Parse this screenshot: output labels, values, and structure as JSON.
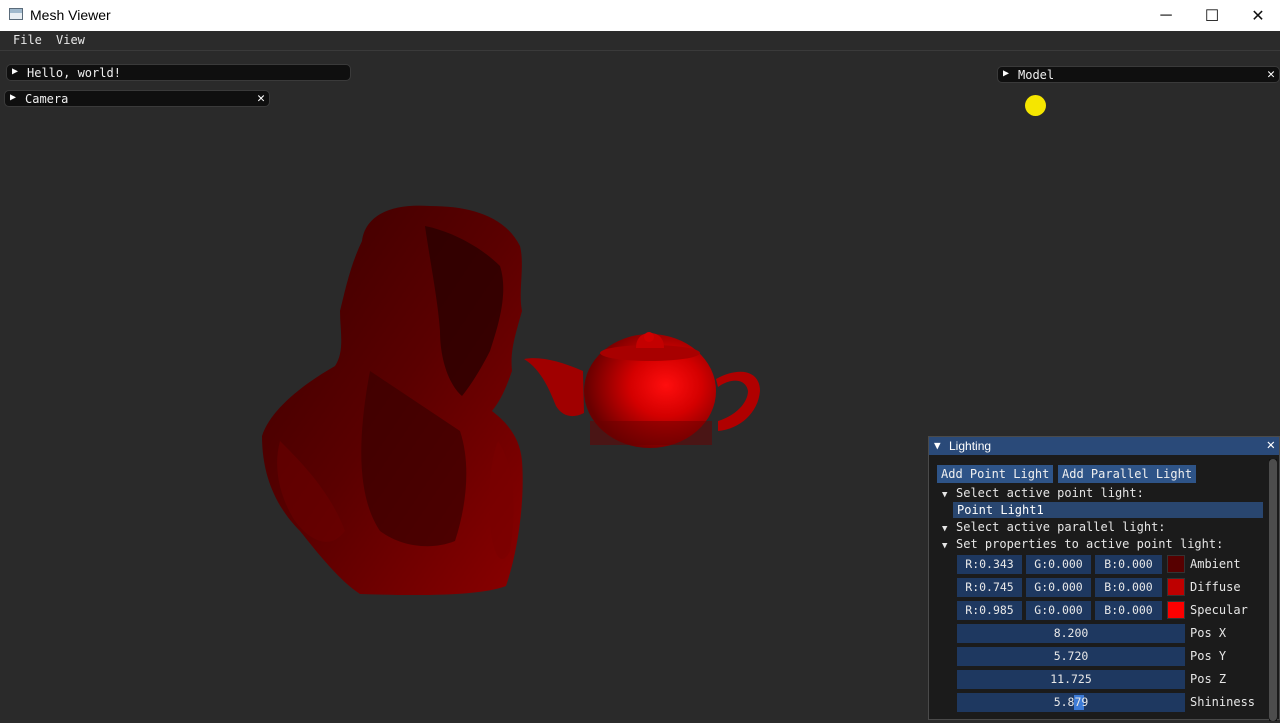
{
  "window": {
    "title": "Mesh Viewer",
    "minimize_icon": "─",
    "maximize_icon": "☐",
    "close_icon": "✕"
  },
  "menu": {
    "file": "File",
    "view": "View"
  },
  "panels": {
    "hello": {
      "label": "Hello, world!"
    },
    "camera": {
      "label": "Camera"
    },
    "model": {
      "label": "Model"
    }
  },
  "lighting": {
    "title": "Lighting",
    "add_point": "Add Point Light",
    "add_parallel": "Add Parallel Light",
    "select_point": "Select active point light:",
    "point_item": "Point Light1",
    "select_parallel": "Select active parallel light:",
    "set_props": "Set properties to active point light:",
    "rows": [
      {
        "r": "R:0.343",
        "g": "G:0.000",
        "b": "B:0.000",
        "label": "Ambient",
        "color": "#570000"
      },
      {
        "r": "R:0.745",
        "g": "G:0.000",
        "b": "B:0.000",
        "label": "Diffuse",
        "color": "#be0000"
      },
      {
        "r": "R:0.985",
        "g": "G:0.000",
        "b": "B:0.000",
        "label": "Specular",
        "color": "#fb0000"
      }
    ],
    "pos_x": {
      "value": "8.200",
      "label": "Pos X"
    },
    "pos_y": {
      "value": "5.720",
      "label": "Pos Y"
    },
    "pos_z": {
      "value": "11.725",
      "label": "Pos Z"
    },
    "shininess": {
      "value": "5.879",
      "label": "Shininess"
    }
  },
  "colors": {
    "model_red": "#cc0000",
    "light_marker": "#f5e600",
    "accent": "#2a4a79"
  }
}
